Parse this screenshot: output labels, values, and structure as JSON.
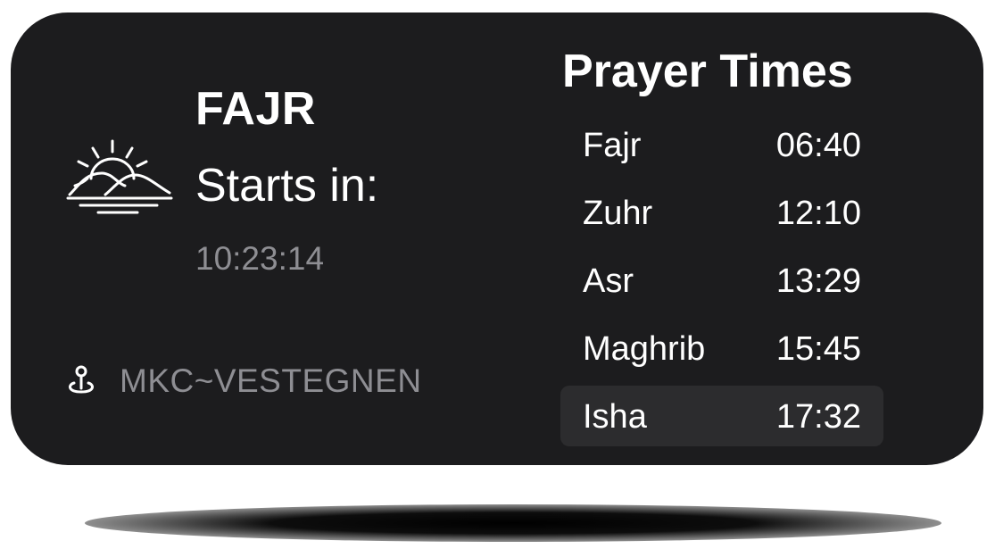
{
  "next_prayer": {
    "name": "FAJR",
    "starts_label": "Starts in:",
    "countdown": "10:23:14",
    "icon": "sunrise-icon"
  },
  "location": {
    "icon": "location-pin-icon",
    "label": "MKC~VESTEGNEN"
  },
  "prayer_times": {
    "title": "Prayer Times",
    "rows": [
      {
        "name": "Fajr",
        "time": "06:40"
      },
      {
        "name": "Zuhr",
        "time": "12:10"
      },
      {
        "name": "Asr",
        "time": "13:29"
      },
      {
        "name": "Maghrib",
        "time": "15:45"
      },
      {
        "name": "Isha",
        "time": "17:32",
        "highlighted": true
      }
    ]
  },
  "colors": {
    "widget_background": "#1c1c1e",
    "highlight_row": "#2c2c2e",
    "secondary_text": "#8e8e93",
    "primary_text": "#ffffff"
  }
}
